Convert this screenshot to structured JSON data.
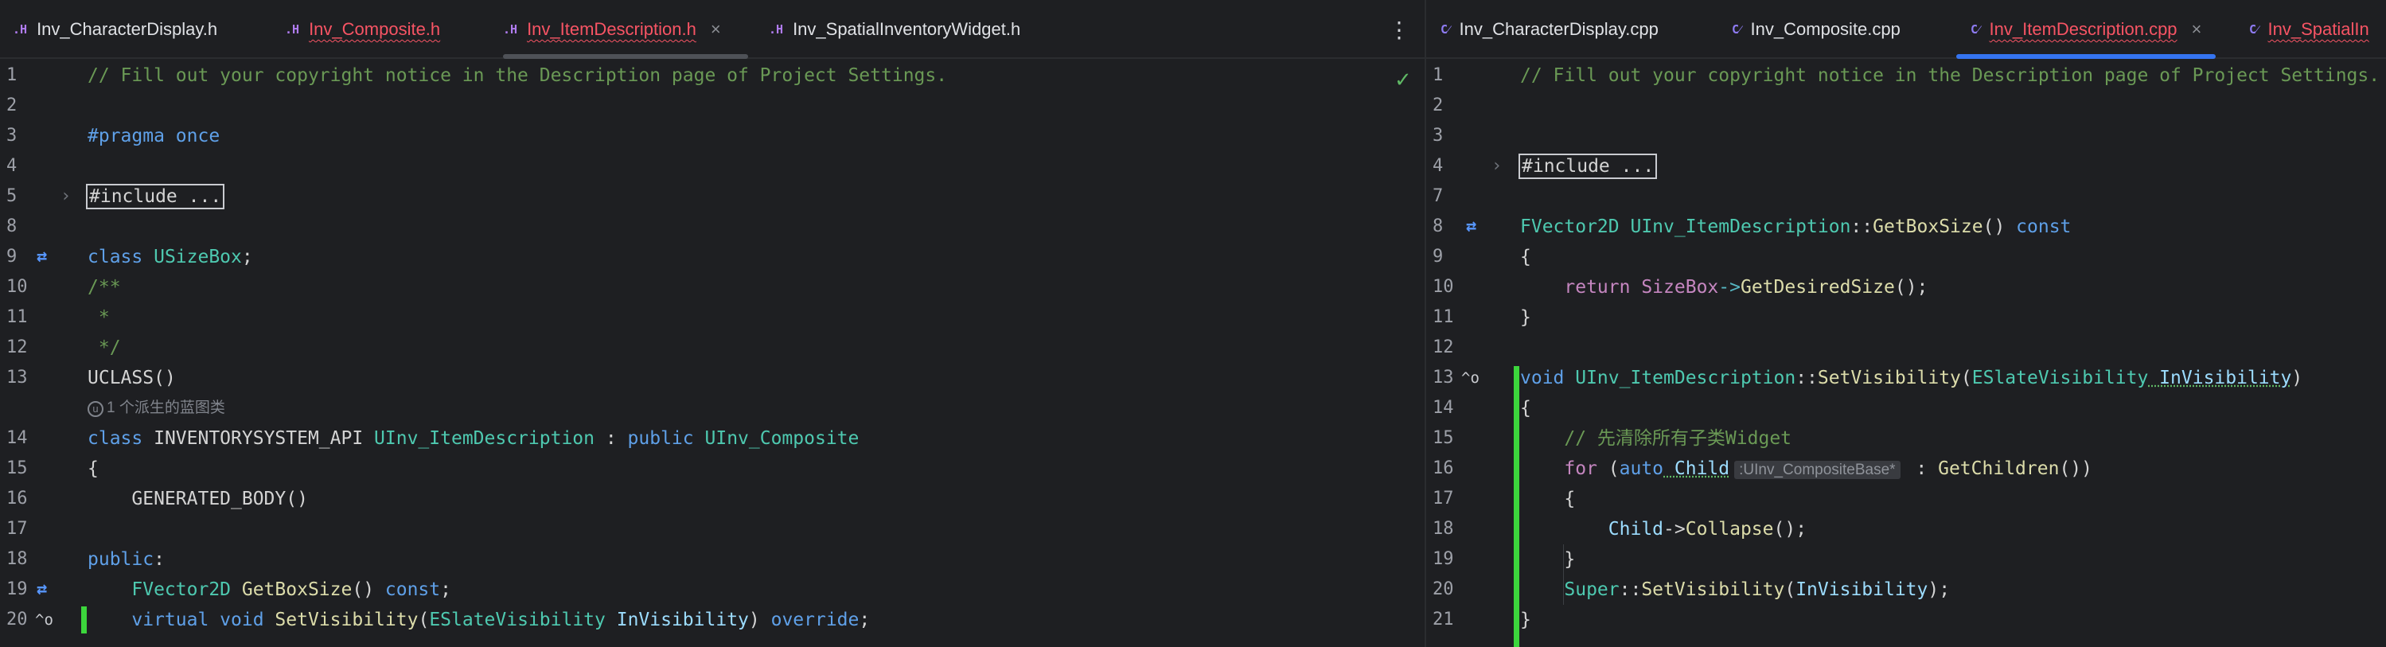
{
  "left": {
    "tabs": [
      {
        "icon": ".H",
        "label": "Inv_CharacterDisplay.h"
      },
      {
        "icon": ".H",
        "label": "Inv_Composite.h"
      },
      {
        "icon": ".H",
        "label": "Inv_ItemDescription.h",
        "close": "×"
      },
      {
        "icon": ".H",
        "label": "Inv_SpatialInventoryWidget.h"
      }
    ],
    "menu_icon": "⋮",
    "status_icon": "✓",
    "lines": {
      "n1": "1",
      "l1": "// Fill out your copyright notice in the Description page of Project Settings.",
      "n2": "2",
      "n3": "3",
      "l3a": "#pragma",
      "l3b": " once",
      "n4": "4",
      "n5": "5",
      "l5": "#include ...",
      "n8": "8",
      "n9": "9",
      "l9a": "class",
      "l9b": " USizeBox",
      "l9c": ";",
      "n10": "10",
      "l10": "/**",
      "n11": "11",
      "l11": " *",
      "n12": "12",
      "l12": " */",
      "n13": "13",
      "l13a": "UCLASS",
      "l13b": "()",
      "hint13": "1 个派生的蓝图类",
      "n14": "14",
      "l14a": "class",
      "l14b": " INVENTORYSYSTEM_API ",
      "l14c": "UInv_ItemDescription",
      "l14d": " : ",
      "l14e": "public",
      "l14f": " ",
      "l14g": "UInv_Composite",
      "n15": "15",
      "l15": "{",
      "n16": "16",
      "l16a": "    GENERATED_BODY",
      "l16b": "()",
      "n17": "17",
      "n18": "18",
      "l18a": "public",
      "l18b": ":",
      "n19": "19",
      "l19a": "    FVector2D",
      "l19b": " GetBoxSize",
      "l19c": "() ",
      "l19d": "const",
      "l19e": ";",
      "n20": "20",
      "l20a": "    virtual",
      "l20b": " void",
      "l20c": " SetVisibility",
      "l20d": "(",
      "l20e": "ESlateVisibility",
      "l20f": " InVisibility",
      "l20g": ") ",
      "l20h": "override",
      "l20i": ";"
    }
  },
  "right": {
    "tabs": [
      {
        "icon": "C⁄",
        "label": "Inv_CharacterDisplay.cpp"
      },
      {
        "icon": "C⁄",
        "label": "Inv_Composite.cpp"
      },
      {
        "icon": "C⁄",
        "label": "Inv_ItemDescription.cpp",
        "close": "×"
      },
      {
        "icon": "C⁄",
        "label": "Inv_SpatialIn"
      }
    ],
    "lines": {
      "n1": "1",
      "l1": "// Fill out your copyright notice in the Description page of Project Settings.",
      "n2": "2",
      "n3": "3",
      "n4": "4",
      "l4": "#include ...",
      "n7": "7",
      "n8": "8",
      "l8a": "FVector2D",
      "l8b": " UInv_ItemDescription",
      "l8c": "::",
      "l8d": "GetBoxSize",
      "l8e": "() ",
      "l8f": "const",
      "n9": "9",
      "l9": "{",
      "n10": "10",
      "l10a": "    return",
      "l10b": " SizeBox",
      "l10c": "->",
      "l10d": "GetDesiredSize",
      "l10e": "();",
      "n11": "11",
      "l11": "}",
      "n12": "12",
      "n13": "13",
      "l13a": "void",
      "l13b": " UInv_ItemDescription",
      "l13c": "::",
      "l13d": "SetVisibility",
      "l13e": "(",
      "l13f": "ESlateVisibility",
      "l13g": " InVisibility",
      "l13h": ")",
      "n14": "14",
      "l14": "{",
      "n15": "15",
      "l15": "    // 先清除所有子类Widget",
      "n16": "16",
      "l16a": "    for",
      "l16b": " (",
      "l16c": "auto",
      "l16d": " Child",
      "l16hint": ":UInv_CompositeBase*",
      "l16e": " : ",
      "l16f": "GetChildren",
      "l16g": "())",
      "n17": "17",
      "l17": "    {",
      "n18": "18",
      "l18a": "        Child",
      "l18b": "->",
      "l18c": "Collapse",
      "l18d": "();",
      "n19": "19",
      "l19": "    }",
      "n20": "20",
      "l20a": "    Super",
      "l20b": "::",
      "l20c": "SetVisibility",
      "l20d": "(",
      "l20e": "InVisibility",
      "l20f": ");",
      "n21": "21",
      "l21": "}"
    }
  }
}
